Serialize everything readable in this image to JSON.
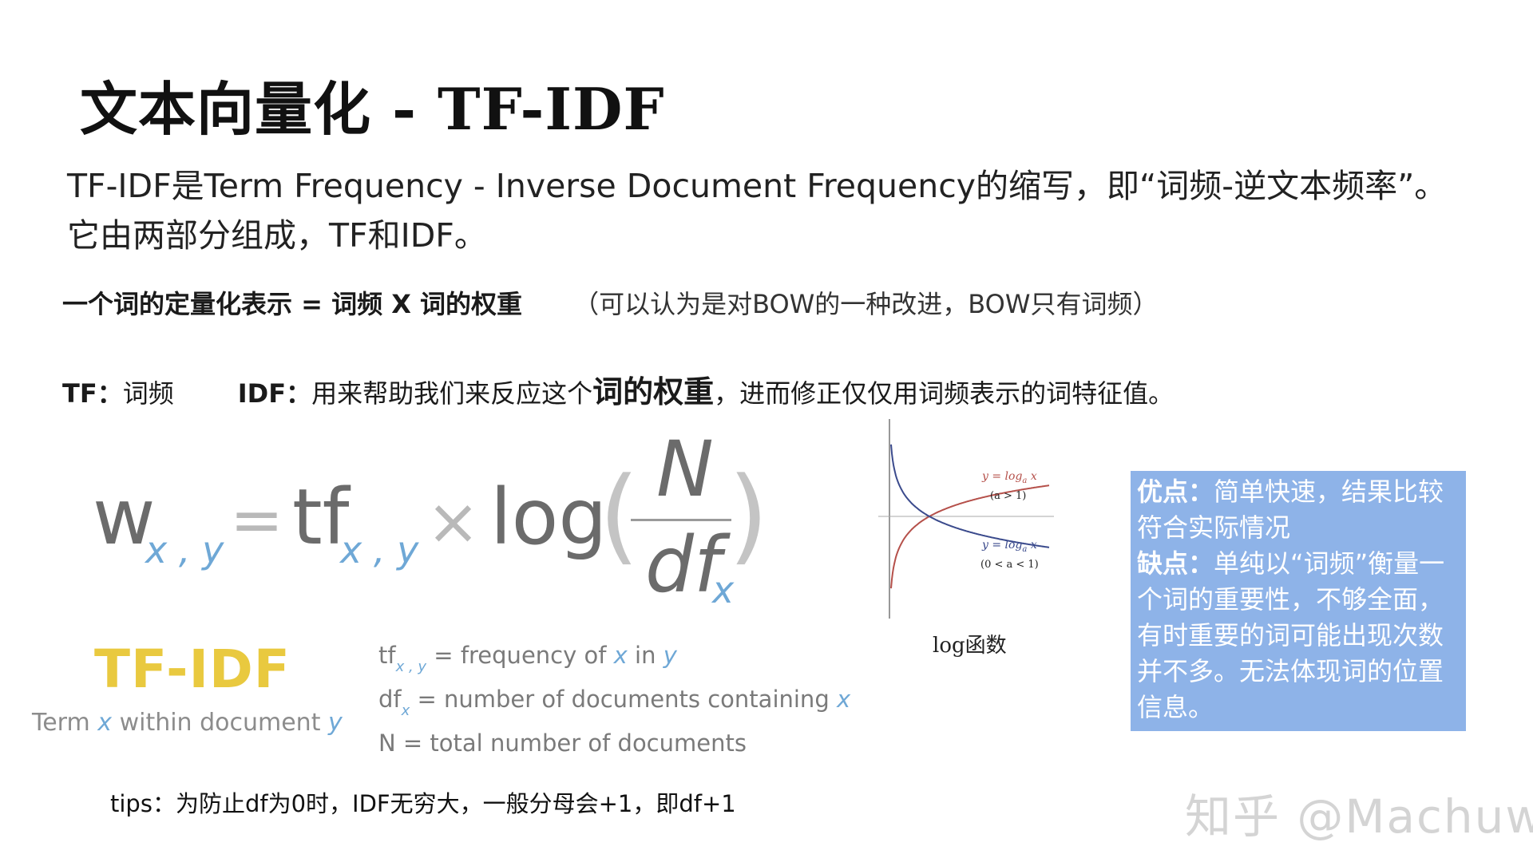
{
  "slide": {
    "title": "文本向量化 - TF-IDF",
    "intro": "TF-IDF是Term Frequency - Inverse Document Frequency的缩写，即“词频-逆文本频率”。它由两部分组成，TF和IDF。",
    "definition": {
      "lhs": "一个词的定量化表示 = 词频 X 词的权重",
      "note": "（可以认为是对BOW的一种改进，BOW只有词频）"
    },
    "tf_label": "TF：",
    "tf_text": "词频",
    "idf_label": "IDF：",
    "idf_text_before": "用来帮助我们来反应这个",
    "idf_emphasis": "词的权重",
    "idf_text_after": "，进而修正仅仅用词频表示的词特征值。",
    "formula": {
      "w": "w",
      "sub_xy": "x , y",
      "eq": "=",
      "tf": "tf",
      "times": "×",
      "log": "log",
      "lparen": "(",
      "rparen": ")",
      "numerator": "N",
      "denominator": "df",
      "den_sub": "x"
    },
    "tfidf_logo": "TF-IDF",
    "tfidf_caption": {
      "p1": "Term ",
      "v1": "x",
      "p2": " within document ",
      "v2": "y"
    },
    "legend": {
      "l1_a": "tf",
      "l1_sub": "x , y",
      "l1_b": " = frequency of ",
      "l1_v1": "x",
      "l1_c": " in ",
      "l1_v2": "y",
      "l2_a": "df",
      "l2_sub": "x",
      "l2_b": " = number of documents containing ",
      "l2_v": "x",
      "l3": "N = total number of documents"
    },
    "graph": {
      "label1": "y = log",
      "label1_sub": "a",
      "label1_x": " x",
      "cond1": "(a > 1)",
      "label2": "y = log",
      "label2_sub": "a",
      "label2_x": " x",
      "cond2": "(0 < a < 1)",
      "caption": "log函数",
      "colors": {
        "increasing": "#b5504a",
        "decreasing": "#3a4a8c"
      }
    },
    "pros_cons": {
      "pros_label": "优点：",
      "pros_text": "简单快速，结果比较符合实际情况",
      "cons_label": "缺点：",
      "cons_text": "单纯以“词频”衡量一个词的重要性，不够全面，有时重要的词可能出现次数并不多。无法体现词的位置信息。",
      "bg_color": "#8eb3e8"
    },
    "tips": "tips：为防止df为0时，IDF无穷大，一般分母会+1，即df+1",
    "watermark": "知乎 @Machuw"
  }
}
